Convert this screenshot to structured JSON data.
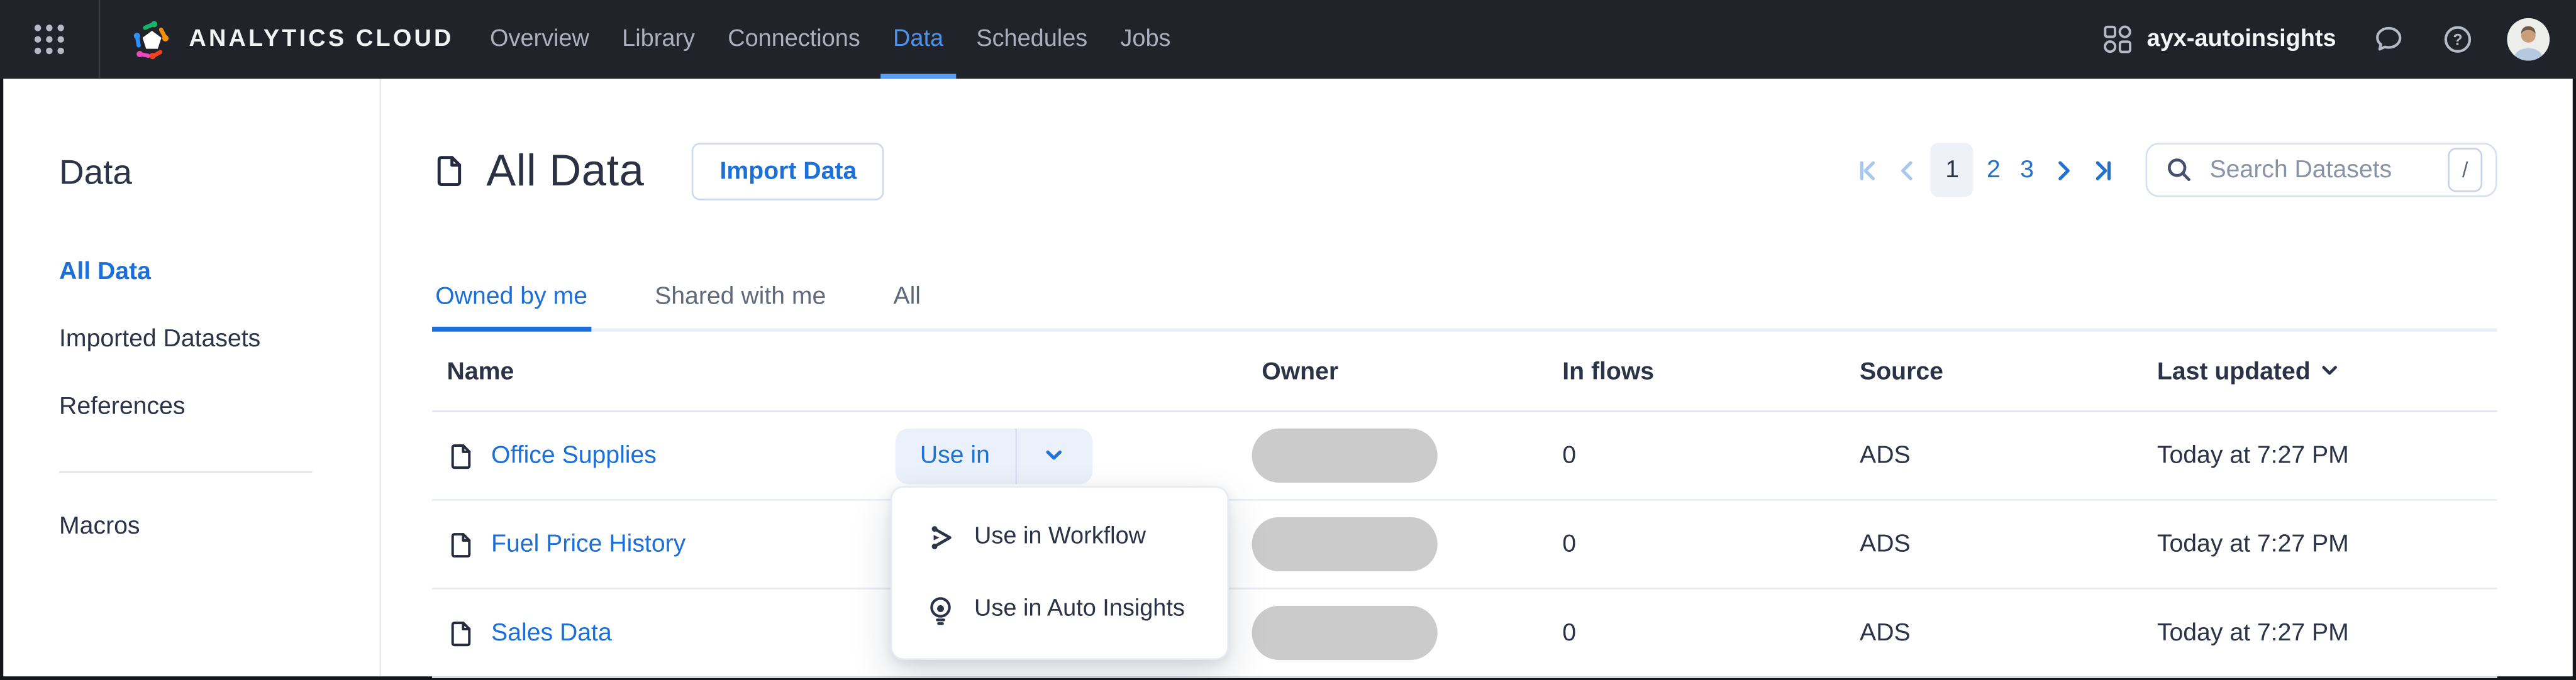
{
  "header": {
    "brand": "ANALYTICS CLOUD",
    "nav": [
      {
        "label": "Overview",
        "active": false
      },
      {
        "label": "Library",
        "active": false
      },
      {
        "label": "Connections",
        "active": false
      },
      {
        "label": "Data",
        "active": true
      },
      {
        "label": "Schedules",
        "active": false
      },
      {
        "label": "Jobs",
        "active": false
      }
    ],
    "workspace": "ayx-autoinsights"
  },
  "sidebar": {
    "title": "Data",
    "items": [
      {
        "label": "All Data",
        "active": true
      },
      {
        "label": "Imported Datasets",
        "active": false
      },
      {
        "label": "References",
        "active": false
      }
    ],
    "secondary_items": [
      {
        "label": "Macros",
        "active": false
      }
    ]
  },
  "main": {
    "page_title": "All Data",
    "import_button_label": "Import Data",
    "pagination": {
      "current_page": "1",
      "pages": [
        "1",
        "2",
        "3"
      ]
    },
    "search": {
      "placeholder": "Search Datasets",
      "shortcut_key": "/"
    },
    "tabs": [
      {
        "label": "Owned by me",
        "active": true
      },
      {
        "label": "Shared with me",
        "active": false
      },
      {
        "label": "All",
        "active": false
      }
    ],
    "table": {
      "columns": [
        "Name",
        "Owner",
        "In flows",
        "Source",
        "Last updated"
      ],
      "sorted_by": "Last updated",
      "sort_direction": "descending",
      "rows": [
        {
          "name": "Office Supplies",
          "in_flows": "0",
          "source": "ADS",
          "last_updated": "Today at 7:27 PM"
        },
        {
          "name": "Fuel Price History",
          "in_flows": "0",
          "source": "ADS",
          "last_updated": "Today at 7:27 PM"
        },
        {
          "name": "Sales Data",
          "in_flows": "0",
          "source": "ADS",
          "last_updated": "Today at 7:27 PM"
        }
      ]
    },
    "use_in_button_label": "Use in",
    "use_in_menu": {
      "items": [
        {
          "label": "Use in Workflow",
          "icon": "workflow-icon"
        },
        {
          "label": "Use in Auto Insights",
          "icon": "auto-insights-icon"
        }
      ]
    }
  },
  "colors": {
    "top_bar": "#20232a",
    "accent_blue": "#1b6fd6",
    "nav_active_blue": "#4f94ea",
    "text_dark": "#2c3347",
    "text_gray": "#606a7b",
    "owner_placeholder": "#cbcbcb",
    "row_border": "#e8ecf3"
  }
}
